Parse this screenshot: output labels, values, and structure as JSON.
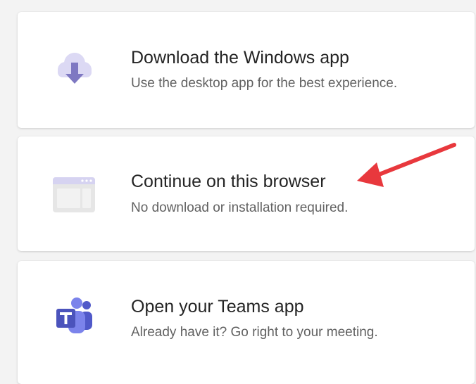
{
  "options": [
    {
      "title": "Download the Windows app",
      "subtitle": "Use the desktop app for the best experience.",
      "icon": "cloud-download-icon"
    },
    {
      "title": "Continue on this browser",
      "subtitle": "No download or installation required.",
      "icon": "browser-window-icon"
    },
    {
      "title": "Open your Teams app",
      "subtitle": "Already have it? Go right to your meeting.",
      "icon": "teams-logo-icon"
    }
  ],
  "colors": {
    "card_background": "#ffffff",
    "page_background": "#f3f3f3",
    "title_text": "#242424",
    "subtitle_text": "#616161",
    "icon_purple_light": "#d9d5f2",
    "icon_purple": "#7b83eb",
    "teams_dark": "#4b53bc",
    "teams_mid": "#5059c9",
    "annotation_arrow": "#e8383d"
  }
}
